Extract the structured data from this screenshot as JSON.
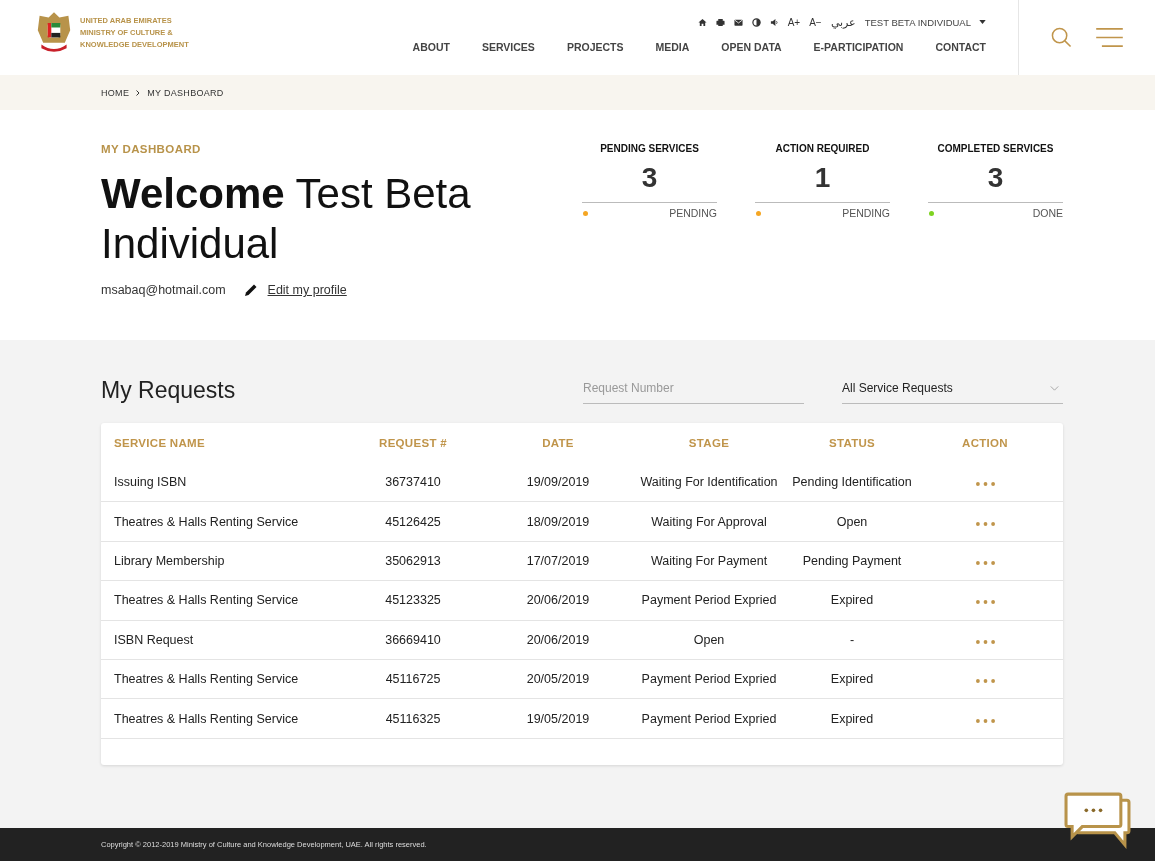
{
  "logo": {
    "lines": [
      "UNITED ARAB EMIRATES",
      "MINISTRY OF CULTURE &",
      "KNOWLEDGE DEVELOPMENT"
    ]
  },
  "utility_bar": {
    "font_larger": "A+",
    "font_smaller": "A−",
    "language": "عربي",
    "user": "TEST BETA INDIVIDUAL"
  },
  "nav": [
    "ABOUT",
    "SERVICES",
    "PROJECTS",
    "MEDIA",
    "OPEN DATA",
    "E-PARTICIPATION",
    "CONTACT"
  ],
  "breadcrumb": [
    "HOME",
    "MY DASHBOARD"
  ],
  "hero": {
    "eyebrow": "MY DASHBOARD",
    "welcome_bold": "Welcome",
    "welcome_name": "Test Beta Individual",
    "email": "msabaq@hotmail.com",
    "edit_link": "Edit my profile"
  },
  "stats": [
    {
      "title": "PENDING SERVICES",
      "count": "3",
      "status": "PENDING",
      "color": "#f5a623"
    },
    {
      "title": "ACTION REQUIRED",
      "count": "1",
      "status": "PENDING",
      "color": "#f5a623"
    },
    {
      "title": "COMPLETED SERVICES",
      "count": "3",
      "status": "DONE",
      "color": "#7ed321"
    }
  ],
  "requests": {
    "title": "My Requests",
    "search": {
      "placeholder": "Request Number"
    },
    "filter": {
      "value": "All Service Requests"
    },
    "table": {
      "columns": [
        "SERVICE NAME",
        "REQUEST #",
        "DATE",
        "STAGE",
        "STATUS",
        "ACTION"
      ],
      "rows": [
        [
          "Issuing ISBN",
          "36737410",
          "19/09/2019",
          "Waiting For Identification",
          "Pending Identification"
        ],
        [
          "Theatres & Halls Renting Service",
          "45126425",
          "18/09/2019",
          "Waiting For Approval",
          "Open"
        ],
        [
          "Library Membership",
          "35062913",
          "17/07/2019",
          "Waiting For Payment",
          "Pending Payment"
        ],
        [
          "Theatres & Halls Renting Service",
          "45123325",
          "20/06/2019",
          "Payment Period Expried",
          "Expired"
        ],
        [
          "ISBN Request",
          "36669410",
          "20/06/2019",
          "Open",
          "-"
        ],
        [
          "Theatres & Halls Renting Service",
          "45116725",
          "20/05/2019",
          "Payment Period Expried",
          "Expired"
        ],
        [
          "Theatres & Halls Renting Service",
          "45116325",
          "19/05/2019",
          "Payment Period Expried",
          "Expired"
        ]
      ]
    }
  },
  "footer": {
    "copyright": "Copyright © 2012-2019 Ministry of Culture and Knowledge Development, UAE. All rights reserved."
  }
}
